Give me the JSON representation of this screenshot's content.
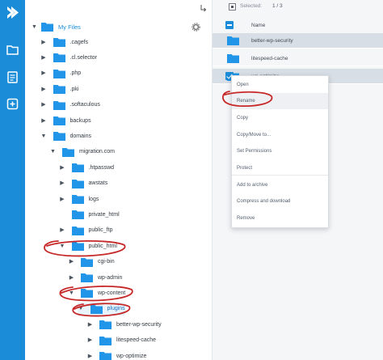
{
  "sidebar": {
    "icons": [
      "logo-icon",
      "folder-icon",
      "document-icon",
      "add-icon"
    ]
  },
  "tree": {
    "root_label": "My Files",
    "items": [
      {
        "label": ".cagefs",
        "depth": 1
      },
      {
        "label": ".cl.selector",
        "depth": 1
      },
      {
        "label": ".php",
        "depth": 1
      },
      {
        "label": ".pki",
        "depth": 1
      },
      {
        "label": ".softaculous",
        "depth": 1
      },
      {
        "label": "backups",
        "depth": 1
      },
      {
        "label": "domains",
        "depth": 1
      },
      {
        "label": "migration.com",
        "depth": 2
      },
      {
        "label": ".htpasswd",
        "depth": 3
      },
      {
        "label": "awstats",
        "depth": 3
      },
      {
        "label": "logs",
        "depth": 3
      },
      {
        "label": "private_html",
        "depth": 3
      },
      {
        "label": "public_ftp",
        "depth": 3
      },
      {
        "label": "public_html",
        "depth": 3
      },
      {
        "label": "cgi-bin",
        "depth": 4
      },
      {
        "label": "wp-admin",
        "depth": 4
      },
      {
        "label": "wp-content",
        "depth": 4
      },
      {
        "label": "plugins",
        "depth": 5
      },
      {
        "label": "better-wp-security",
        "depth": 6
      },
      {
        "label": "litespeed-cache",
        "depth": 6
      },
      {
        "label": "wp-optimize",
        "depth": 6
      }
    ]
  },
  "files": {
    "selected_label": "Selected:",
    "selected_count": "1 / 3",
    "column_name": "Name",
    "rows": [
      "better-wp-security",
      "litespeed-cache",
      "wp-optimize"
    ]
  },
  "context_menu": {
    "items": [
      "Open",
      "Rename",
      "Copy",
      "Copy/Move to...",
      "Set Permissions",
      "Protect",
      "Add to archive",
      "Compress and download",
      "Remove"
    ]
  },
  "colors": {
    "accent": "#1a8cd8",
    "folder": "#2196e8",
    "annotation": "#c62828"
  }
}
